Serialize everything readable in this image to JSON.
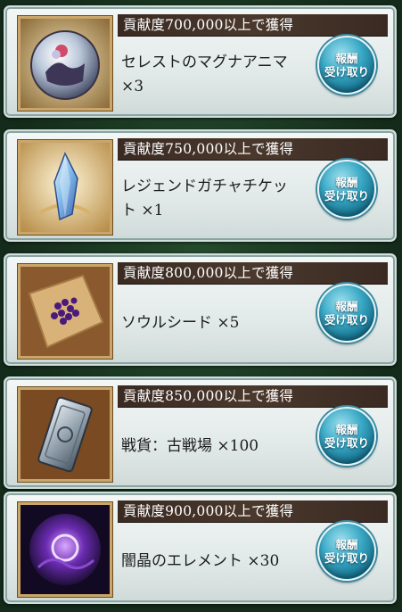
{
  "rewards": [
    {
      "condition": "貢献度700,000以上で獲得",
      "item_lines": [
        "セレストのマグナアニマ",
        "×3"
      ],
      "item_icon": "celeste-anima-orb-icon",
      "claim_line1": "報酬",
      "claim_line2": "受け取り"
    },
    {
      "condition": "貢献度750,000以上で獲得",
      "item_lines": [
        "レジェンドガチャチケッ",
        "ト ×1"
      ],
      "item_icon": "legend-gacha-ticket-crystal-icon",
      "claim_line1": "報酬",
      "claim_line2": "受け取り"
    },
    {
      "condition": "貢献度800,000以上で獲得",
      "item_lines": [
        "ソウルシード ×5"
      ],
      "item_icon": "soul-seed-icon",
      "claim_line1": "報酬",
      "claim_line2": "受け取り"
    },
    {
      "condition": "貢献度850,000以上で獲得",
      "item_lines": [
        "戦貨：古戦場 ×100"
      ],
      "item_icon": "war-medal-plate-icon",
      "claim_line1": "報酬",
      "claim_line2": "受け取り"
    },
    {
      "condition": "貢献度900,000以上で獲得",
      "item_lines": [
        "闇晶のエレメント ×30"
      ],
      "item_icon": "dark-element-crystal-icon",
      "claim_line1": "報酬",
      "claim_line2": "受け取り"
    }
  ]
}
